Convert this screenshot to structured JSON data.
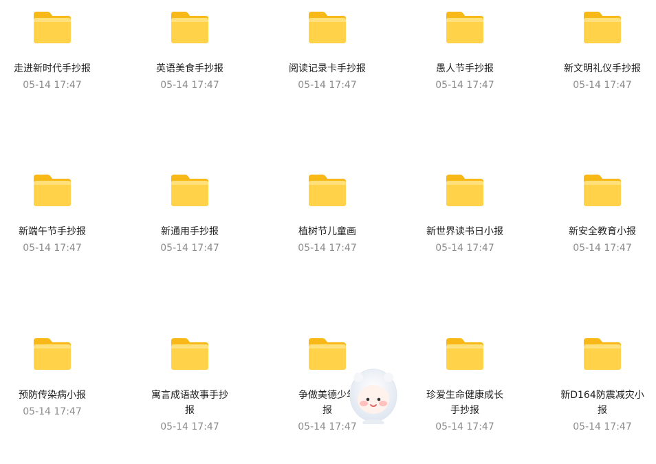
{
  "items": [
    {
      "name": "走进新时代手抄报",
      "time": "05-14 17:47"
    },
    {
      "name": "英语美食手抄报",
      "time": "05-14 17:47"
    },
    {
      "name": "阅读记录卡手抄报",
      "time": "05-14 17:47"
    },
    {
      "name": "愚人节手抄报",
      "time": "05-14 17:47"
    },
    {
      "name": "新文明礼仪手抄报",
      "time": "05-14 17:47"
    },
    {
      "name": "新端午节手抄报",
      "time": "05-14 17:47"
    },
    {
      "name": "新通用手抄报",
      "time": "05-14 17:47"
    },
    {
      "name": "植树节儿童画",
      "time": "05-14 17:47"
    },
    {
      "name": "新世界读书日小报",
      "time": "05-14 17:47"
    },
    {
      "name": "新安全教育小报",
      "time": "05-14 17:47"
    },
    {
      "name": "预防传染病小报",
      "time": "05-14 17:47"
    },
    {
      "name": "寓言成语故事手抄报",
      "time": "05-14 17:47"
    },
    {
      "name": "争做美德少年报",
      "time": "05-14 17:47"
    },
    {
      "name": "珍爱生命健康成长手抄报",
      "time": "05-14 17:47"
    },
    {
      "name": "新D164防震减灾小报",
      "time": "05-14 17:47"
    }
  ],
  "icons": {
    "folder": "folder-icon",
    "mascot": "mascot-avatar"
  },
  "colors": {
    "folder_top": "#ffd24a",
    "folder_back": "#f7b818",
    "name": "#1f1f1f",
    "time": "#8c8c8c"
  }
}
